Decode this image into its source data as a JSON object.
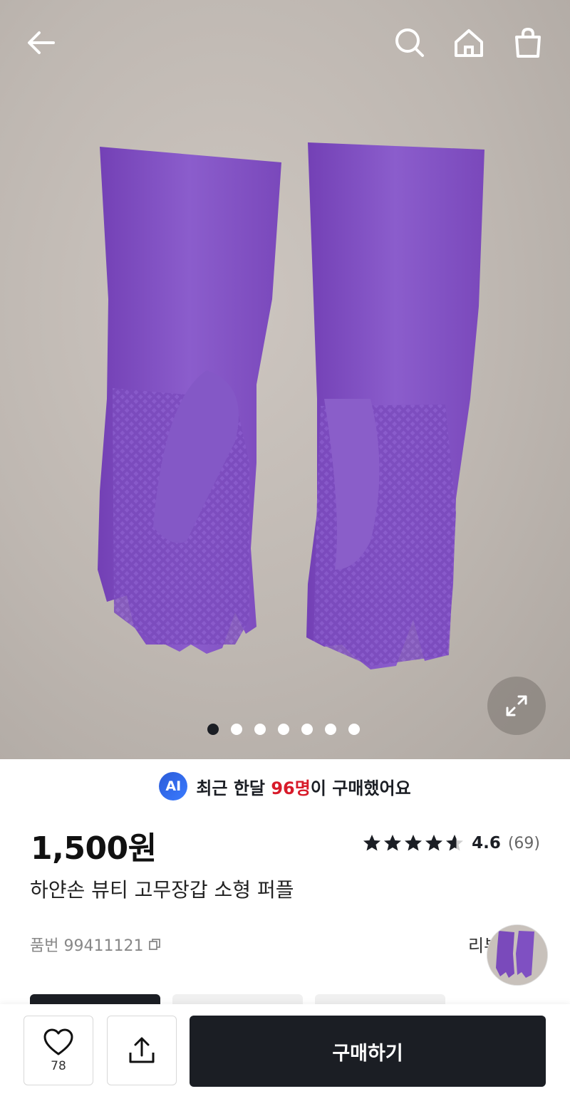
{
  "header": {
    "back_icon": "arrow-left-icon",
    "search_icon": "search-icon",
    "home_icon": "home-icon",
    "cart_icon": "shopping-bag-icon"
  },
  "gallery": {
    "image_count": 7,
    "active_index": 0,
    "expand_icon": "expand-icon",
    "product_color": "#7a4fbf"
  },
  "ai_notice": {
    "badge": "AI",
    "prefix": "최근 한달 ",
    "highlight": "96명",
    "suffix": "이 구매했어요",
    "highlight_color": "#d81b2a"
  },
  "product": {
    "price": "1,500원",
    "rating_stars": 4.6,
    "rating_score": "4.6",
    "review_count": "(69)",
    "name": "하얀손 뷰티 고무장갑 소형 퍼플",
    "sku_label": "품번 99411121",
    "copy_icon": "copy-icon",
    "review_label": "리뷰"
  },
  "bottom_bar": {
    "like_icon": "heart-icon",
    "like_count": "78",
    "share_icon": "share-icon",
    "buy_label": "구매하기"
  },
  "colors": {
    "primary_dark": "#1b1e24",
    "accent_red": "#d81b2a"
  }
}
